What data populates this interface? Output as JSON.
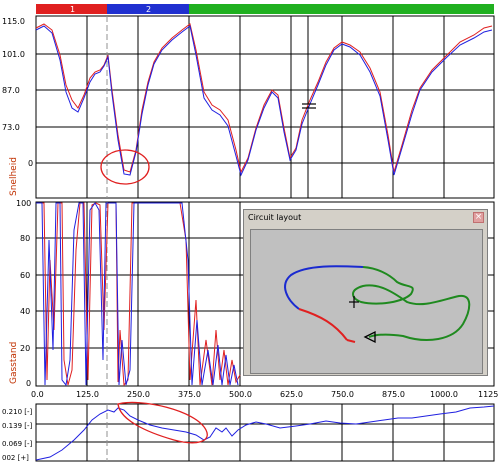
{
  "laps": {
    "lap1": "1",
    "lap2": "2"
  },
  "speed_axis": {
    "label": "Snelheid",
    "ticks": [
      "115.0",
      "101.0",
      "87.0",
      "73.0",
      "0"
    ]
  },
  "throttle_axis": {
    "label": "Gasstand",
    "ticks": [
      "100",
      "80",
      "60",
      "40",
      "20",
      "0"
    ]
  },
  "x_axis": {
    "ticks": [
      "0.0",
      "125.0",
      "250.0",
      "375.0",
      "500.0",
      "625.0",
      "750.0",
      "875.0",
      "1000.0",
      "1125"
    ]
  },
  "delta_axis": {
    "ticks": [
      "0.210 [-]",
      "0.139 [-]",
      "0.069 [-]",
      "002 [+]"
    ]
  },
  "circuit_popup": {
    "title": "Circuit layout",
    "close": "×"
  },
  "colors": {
    "lap1": "#e02020",
    "lap2": "#2020e0",
    "lap3": "#20b020",
    "annotation": "#e02020"
  }
}
